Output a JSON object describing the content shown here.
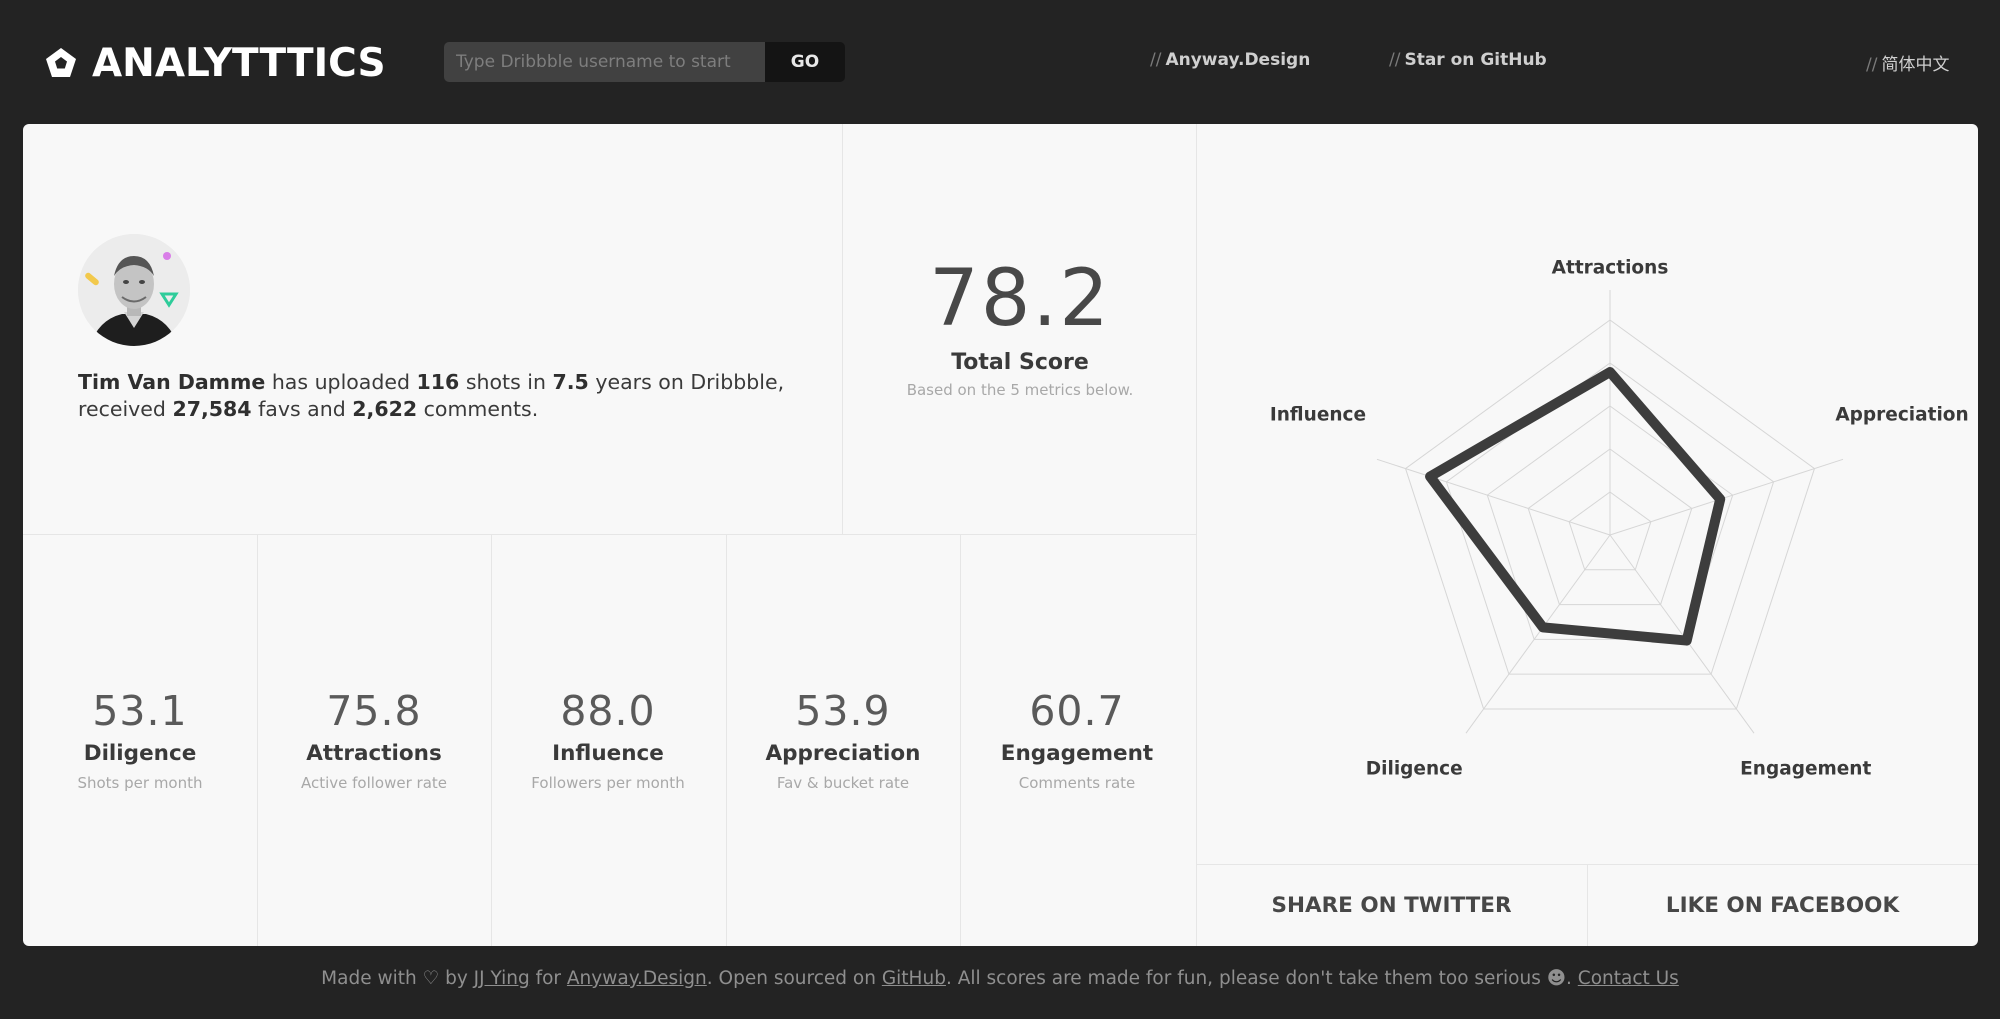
{
  "header": {
    "logo_text": "ANALYTTTICS",
    "logo_icon": "pentagon-icon",
    "search_placeholder": "Type Dribbble username to start",
    "search_value": "",
    "go_label": "GO",
    "nav": [
      {
        "slash": "//",
        "label": "Anyway.Design"
      },
      {
        "slash": "//",
        "label": "Star on GitHub"
      },
      {
        "slash": "//",
        "label": "简体中文"
      }
    ]
  },
  "profile": {
    "name": "Tim Van Damme",
    "t1": " has uploaded ",
    "shots": "116",
    "t2": " shots in ",
    "years": "7.5",
    "t3": " years on Dribbble,",
    "t4": "received ",
    "favs": "27,584",
    "t5": " favs and ",
    "comments": "2,622",
    "t6": " comments."
  },
  "total": {
    "score_int": "78",
    "score_dec": ".2",
    "label": "Total Score",
    "sub": "Based on the 5 metrics below."
  },
  "metrics": [
    {
      "value": "53.1",
      "name": "Diligence",
      "sub": "Shots per month"
    },
    {
      "value": "75.8",
      "name": "Attractions",
      "sub": "Active follower rate"
    },
    {
      "value": "88.0",
      "name": "Influence",
      "sub": "Followers per month"
    },
    {
      "value": "53.9",
      "name": "Appreciation",
      "sub": "Fav & bucket rate"
    },
    {
      "value": "60.7",
      "name": "Engagement",
      "sub": "Comments rate"
    }
  ],
  "chart_data": {
    "type": "radar",
    "axes": [
      "Attractions",
      "Appreciation",
      "Engagement",
      "Diligence",
      "Influence"
    ],
    "values": [
      75.8,
      53.9,
      60.7,
      53.1,
      88.0
    ],
    "range": [
      0,
      100
    ],
    "rings": 5,
    "grid": true
  },
  "share": {
    "twitter": "SHARE ON TWITTER",
    "facebook": "LIKE ON FACEBOOK"
  },
  "footer": {
    "t1": "Made with ♡ by ",
    "author": "JJ Ying",
    "t2": " for ",
    "site": "Anyway.Design",
    "t3": ". Open sourced on ",
    "github": "GitHub",
    "t4": ". All scores are made for fun, please don't take them too serious ☻. ",
    "contact": "Contact Us"
  }
}
